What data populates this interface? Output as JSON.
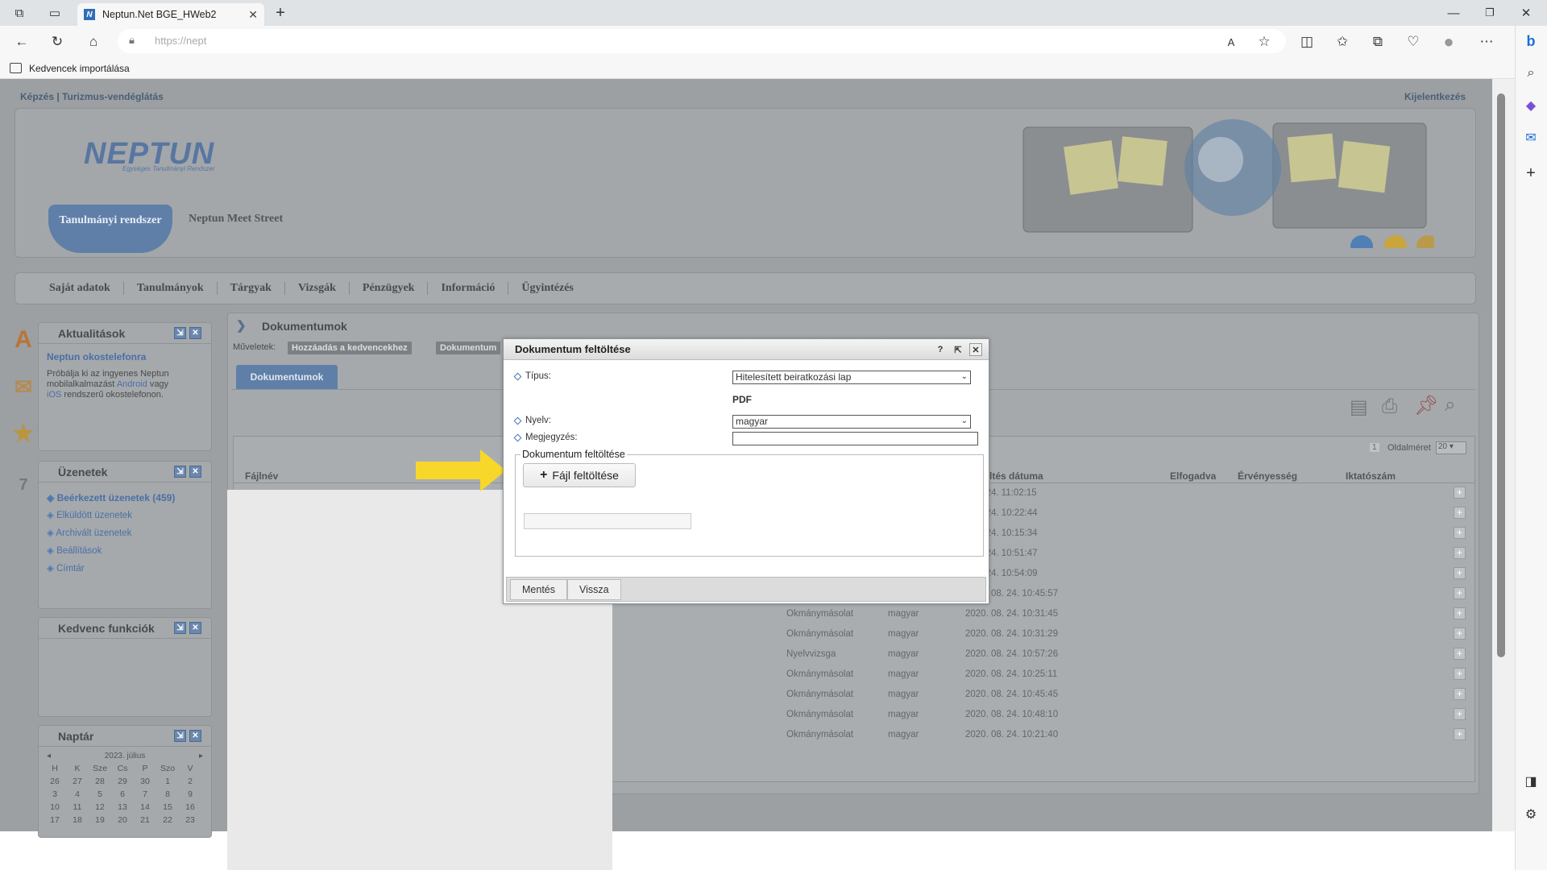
{
  "browser": {
    "tab_title": "Neptun.Net BGE_HWeb2",
    "url": "https://nept",
    "favorites_label": "Kedvencek importálása"
  },
  "page": {
    "top_links": "Képzés |  Turizmus-vendéglátás",
    "logout": "Kijelentkezés",
    "logo": "NEPTUN",
    "logo_sub": "Egységes Tanulmányi Rendszer",
    "tab_study": "Tanulmányi rendszer",
    "tab_meet": "Neptun Meet Street",
    "menu": [
      "Saját adatok",
      "Tanulmányok",
      "Tárgyak",
      "Vizsgák",
      "Pénzügyek",
      "Információ",
      "Ügyintézés"
    ]
  },
  "sidebar": {
    "news": {
      "title": "Aktualitások",
      "item_title": "Neptun okostelefonra",
      "item_text_1": "Próbálja ki az ingyenes Neptun",
      "item_text_2": "mobilalkalmazást",
      "android": "Android",
      "vagy": "vagy",
      "ios": "iOS",
      "item_text_3": "rendszerű okostelefonon."
    },
    "messages": {
      "title": "Üzenetek",
      "items": [
        "Beérkezett üzenetek (459)",
        "Elküldött üzenetek",
        "Archivált üzenetek",
        "Beállítások",
        "Címtár"
      ]
    },
    "favorites": {
      "title": "Kedvenc funkciók"
    },
    "calendar": {
      "title": "Naptár",
      "month": "2023. július",
      "days": [
        "H",
        "K",
        "Sze",
        "Cs",
        "P",
        "Szo",
        "V"
      ],
      "weeks": [
        [
          "26",
          "27",
          "28",
          "29",
          "30",
          "1",
          "2"
        ],
        [
          "3",
          "4",
          "5",
          "6",
          "7",
          "8",
          "9"
        ],
        [
          "10",
          "11",
          "12",
          "13",
          "14",
          "15",
          "16"
        ],
        [
          "17",
          "18",
          "19",
          "20",
          "21",
          "22",
          "23"
        ]
      ]
    }
  },
  "content": {
    "breadcrumb": "Dokumentumok",
    "actions_label": "Műveletek:",
    "action_fav": "Hozzáadás a kedvencekhez",
    "action_doc": "Dokumentum",
    "tab": "Dokumentumok",
    "page_size_label": "Oldalméret",
    "page_size": "20",
    "page_num": "1",
    "col_filename": "Fájlnév",
    "col_upload_date": "ltés dátuma",
    "col_accepted": "Elfogadva",
    "col_validity": "Érvényesség",
    "col_reg": "Iktatószám",
    "rows": [
      {
        "type": "",
        "lang": "",
        "date": ". 08. 24. 11:02:15"
      },
      {
        "type": "",
        "lang": "",
        "date": ". 08. 24. 10:22:44"
      },
      {
        "type": "",
        "lang": "",
        "date": ". 08. 24. 10:15:34"
      },
      {
        "type": "",
        "lang": "",
        "date": ". 08. 24. 10:51:47"
      },
      {
        "type": "",
        "lang": "",
        "date": ". 08. 24. 10:54:09"
      },
      {
        "type": "",
        "lang": "magyar",
        "date": "2020. 08. 24. 10:45:57"
      },
      {
        "type": "Okmánymásolat",
        "lang": "magyar",
        "date": "2020. 08. 24. 10:31:45"
      },
      {
        "type": "Okmánymásolat",
        "lang": "magyar",
        "date": "2020. 08. 24. 10:31:29"
      },
      {
        "type": "Nyelvvizsga",
        "lang": "magyar",
        "date": "2020. 08. 24. 10:57:26"
      },
      {
        "type": "Okmánymásolat",
        "lang": "magyar",
        "date": "2020. 08. 24. 10:25:11"
      },
      {
        "type": "Okmánymásolat",
        "lang": "magyar",
        "date": "2020. 08. 24. 10:45:45"
      },
      {
        "type": "Okmánymásolat",
        "lang": "magyar",
        "date": "2020. 08. 24. 10:48:10"
      },
      {
        "type": "Okmánymásolat",
        "lang": "magyar",
        "date": "2020. 08. 24. 10:21:40"
      }
    ]
  },
  "dialog": {
    "title": "Dokumentum feltöltése",
    "help": "?",
    "type_label": "Típus:",
    "type_value": "Hitelesített beiratkozási lap",
    "format": "PDF",
    "lang_label": "Nyelv:",
    "lang_value": "magyar",
    "note_label": "Megjegyzés:",
    "note_value": "",
    "fieldset_legend": "Dokumentum feltöltése",
    "upload_button": "Fájl feltöltése",
    "save": "Mentés",
    "back": "Vissza"
  },
  "colors": {
    "arrow": "#f7d82a",
    "neptun_blue": "#5f7fa8",
    "link": "#4a6fa5"
  }
}
